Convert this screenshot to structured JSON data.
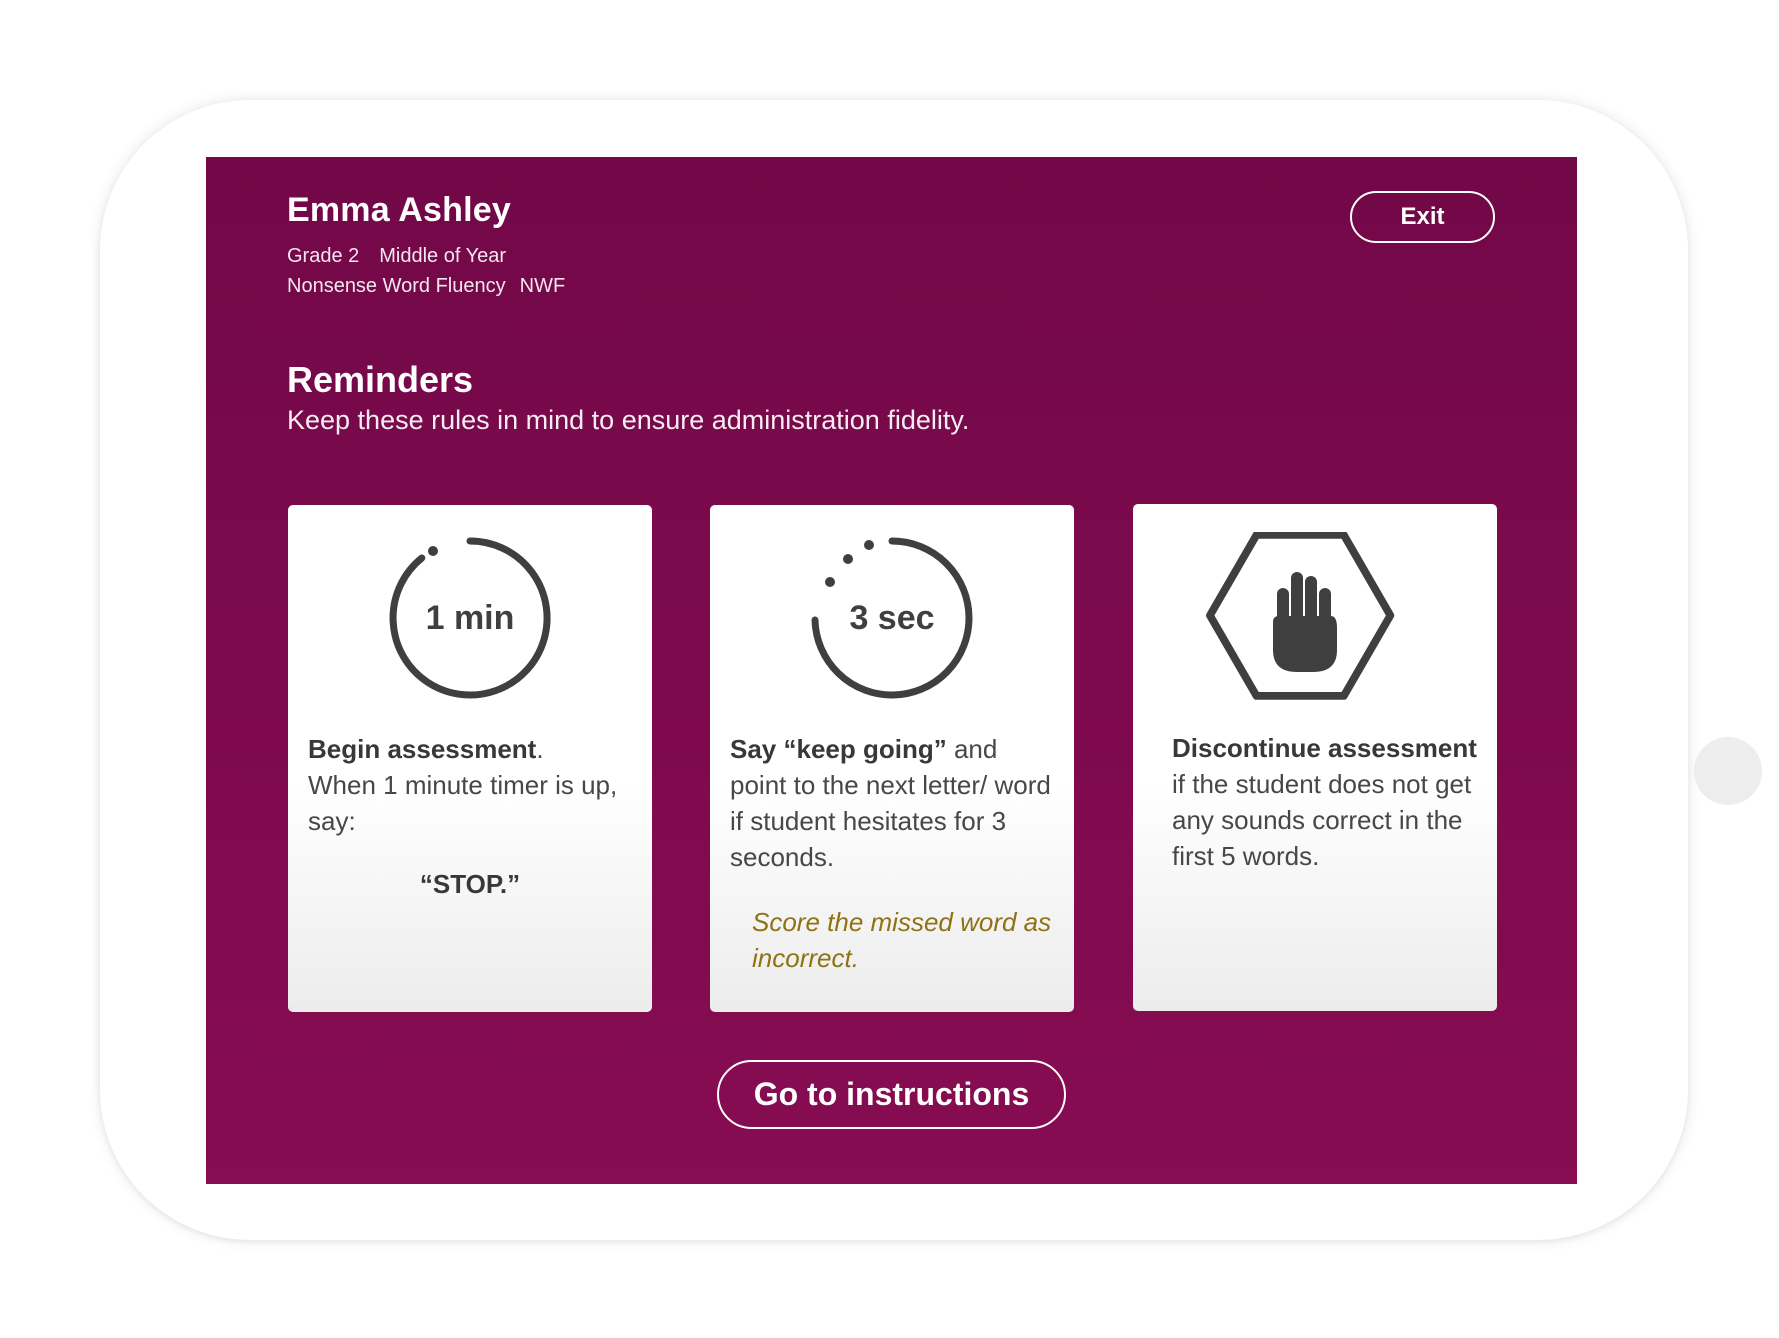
{
  "header": {
    "student_name": "Emma Ashley",
    "grade": "Grade 2",
    "period": "Middle of Year",
    "measure": "Nonsense Word Fluency",
    "measure_code": "NWF",
    "exit_label": "Exit"
  },
  "reminders": {
    "title": "Reminders",
    "subtitle": "Keep these rules in mind to ensure administration fidelity."
  },
  "cards": [
    {
      "icon": "timer-icon",
      "icon_label": "1 min",
      "bold": "Begin assessment",
      "text_after_bold": ".",
      "text": "When 1 minute timer is up, say:",
      "quote": "“STOP.”"
    },
    {
      "icon": "timer-icon",
      "icon_label": "3 sec",
      "prefix": "Say ",
      "bold": "“keep going”",
      "text": " and point to the next letter/ word if student hesitates for 3 seconds.",
      "note": "Score the missed word as incorrect."
    },
    {
      "icon": "stop-hand-icon",
      "bold": "Discontinue assessment",
      "text": " if the student does not get any sounds correct in the first 5 words."
    }
  ],
  "footer": {
    "go_label": "Go to instructions"
  },
  "colors": {
    "screen_top": "#720847",
    "screen_bottom": "#870c52",
    "icon": "#3f3f3f",
    "note": "#8e7214"
  }
}
